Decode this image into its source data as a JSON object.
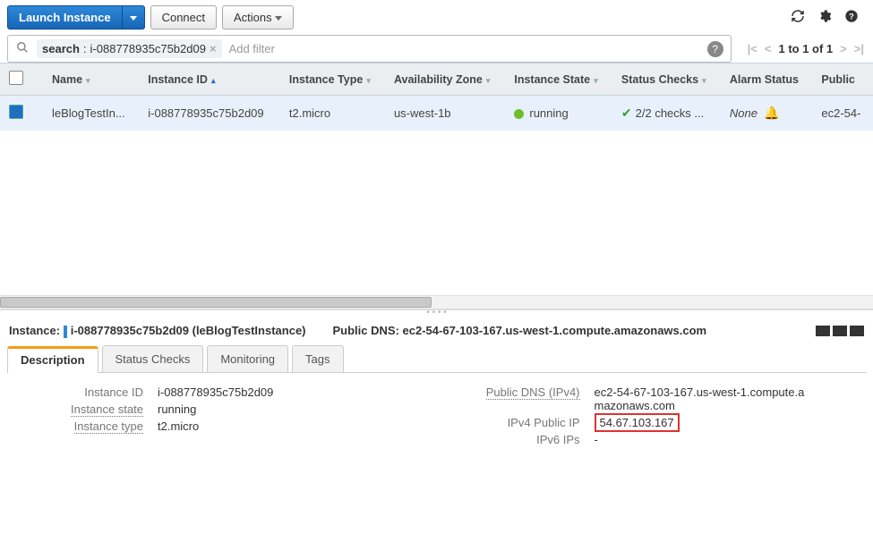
{
  "toolbar": {
    "launch": "Launch Instance",
    "connect": "Connect",
    "actions": "Actions"
  },
  "search": {
    "tag_key": "search",
    "tag_val": "i-088778935c75b2d09",
    "placeholder": "Add filter"
  },
  "pager": {
    "text": "1 to 1 of 1"
  },
  "columns": {
    "name": "Name",
    "instance_id": "Instance ID",
    "instance_type": "Instance Type",
    "az": "Availability Zone",
    "state": "Instance State",
    "checks": "Status Checks",
    "alarm": "Alarm Status",
    "public": "Public"
  },
  "row": {
    "name": "leBlogTestIn...",
    "instance_id": "i-088778935c75b2d09",
    "instance_type": "t2.micro",
    "az": "us-west-1b",
    "state": "running",
    "checks": "2/2 checks ...",
    "alarm": "None",
    "public": "ec2-54-"
  },
  "detail": {
    "label_instance": "Instance:",
    "id": "i-088778935c75b2d09",
    "name": "(leBlogTestInstance)",
    "label_pubdns": "Public DNS:",
    "pubdns": "ec2-54-67-103-167.us-west-1.compute.amazonaws.com"
  },
  "tabs": {
    "description": "Description",
    "status": "Status Checks",
    "monitoring": "Monitoring",
    "tags": "Tags"
  },
  "props": {
    "instance_id_k": "Instance ID",
    "instance_id_v": "i-088778935c75b2d09",
    "state_k": "Instance state",
    "state_v": "running",
    "type_k": "Instance type",
    "type_v": "t2.micro",
    "pubdns_k": "Public DNS (IPv4)",
    "pubdns_v": "ec2-54-67-103-167.us-west-1.compute.amazonaws.com",
    "pubip_k": "IPv4 Public IP",
    "pubip_v": "54.67.103.167",
    "ipv6_k": "IPv6 IPs",
    "ipv6_v": "-"
  }
}
